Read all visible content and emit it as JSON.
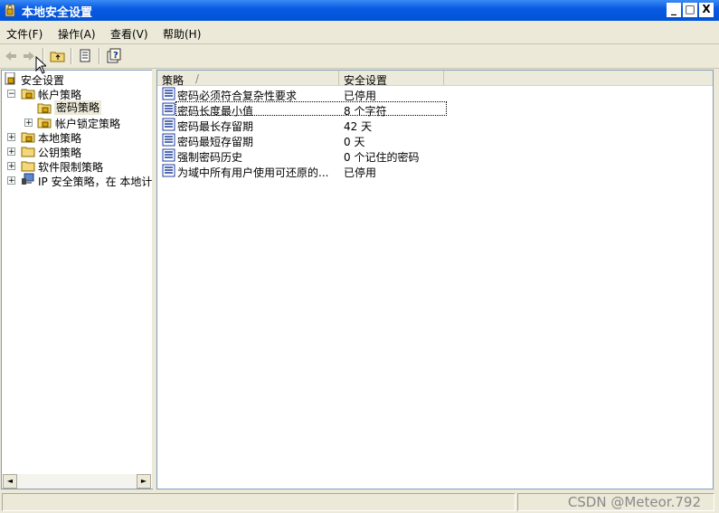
{
  "window": {
    "title": "本地安全设置",
    "minimize": "_",
    "maximize": "□",
    "close": "X"
  },
  "menu": [
    {
      "label": "文件(F)"
    },
    {
      "label": "操作(A)"
    },
    {
      "label": "查看(V)"
    },
    {
      "label": "帮助(H)"
    }
  ],
  "toolbar": {
    "buttons": [
      "back-icon",
      "forward-icon",
      "up-folder-icon",
      "export-list-icon",
      "help-icon"
    ]
  },
  "tree": {
    "root": "安全设置",
    "items": [
      {
        "label": "帐户策略",
        "expander": "−"
      },
      {
        "label": "密码策略",
        "selected": true
      },
      {
        "label": "帐户锁定策略",
        "expander": "+"
      },
      {
        "label": "本地策略",
        "expander": "+"
      },
      {
        "label": "公钥策略",
        "expander": "+"
      },
      {
        "label": "软件限制策略",
        "expander": "+"
      },
      {
        "label": "IP 安全策略，在 本地计算机",
        "expander": "+"
      }
    ]
  },
  "list": {
    "columns": [
      "策略",
      "安全设置"
    ],
    "sort_indicator": "/",
    "rows": [
      {
        "policy": "密码必须符合复杂性要求",
        "setting": "已停用"
      },
      {
        "policy": "密码长度最小值",
        "setting": "8 个字符"
      },
      {
        "policy": "密码最长存留期",
        "setting": "42 天"
      },
      {
        "policy": "密码最短存留期",
        "setting": "0 天"
      },
      {
        "policy": "强制密码历史",
        "setting": "0 个记住的密码"
      },
      {
        "policy": "为域中所有用户使用可还原的...",
        "setting": "已停用"
      }
    ]
  },
  "scroll": {
    "left": "◄",
    "right": "►"
  },
  "watermark": "CSDN @Meteor.792",
  "colors": {
    "title_bar": "#0a5be2",
    "selection": "#ece9d8",
    "pane_border": "#7f9db9"
  }
}
